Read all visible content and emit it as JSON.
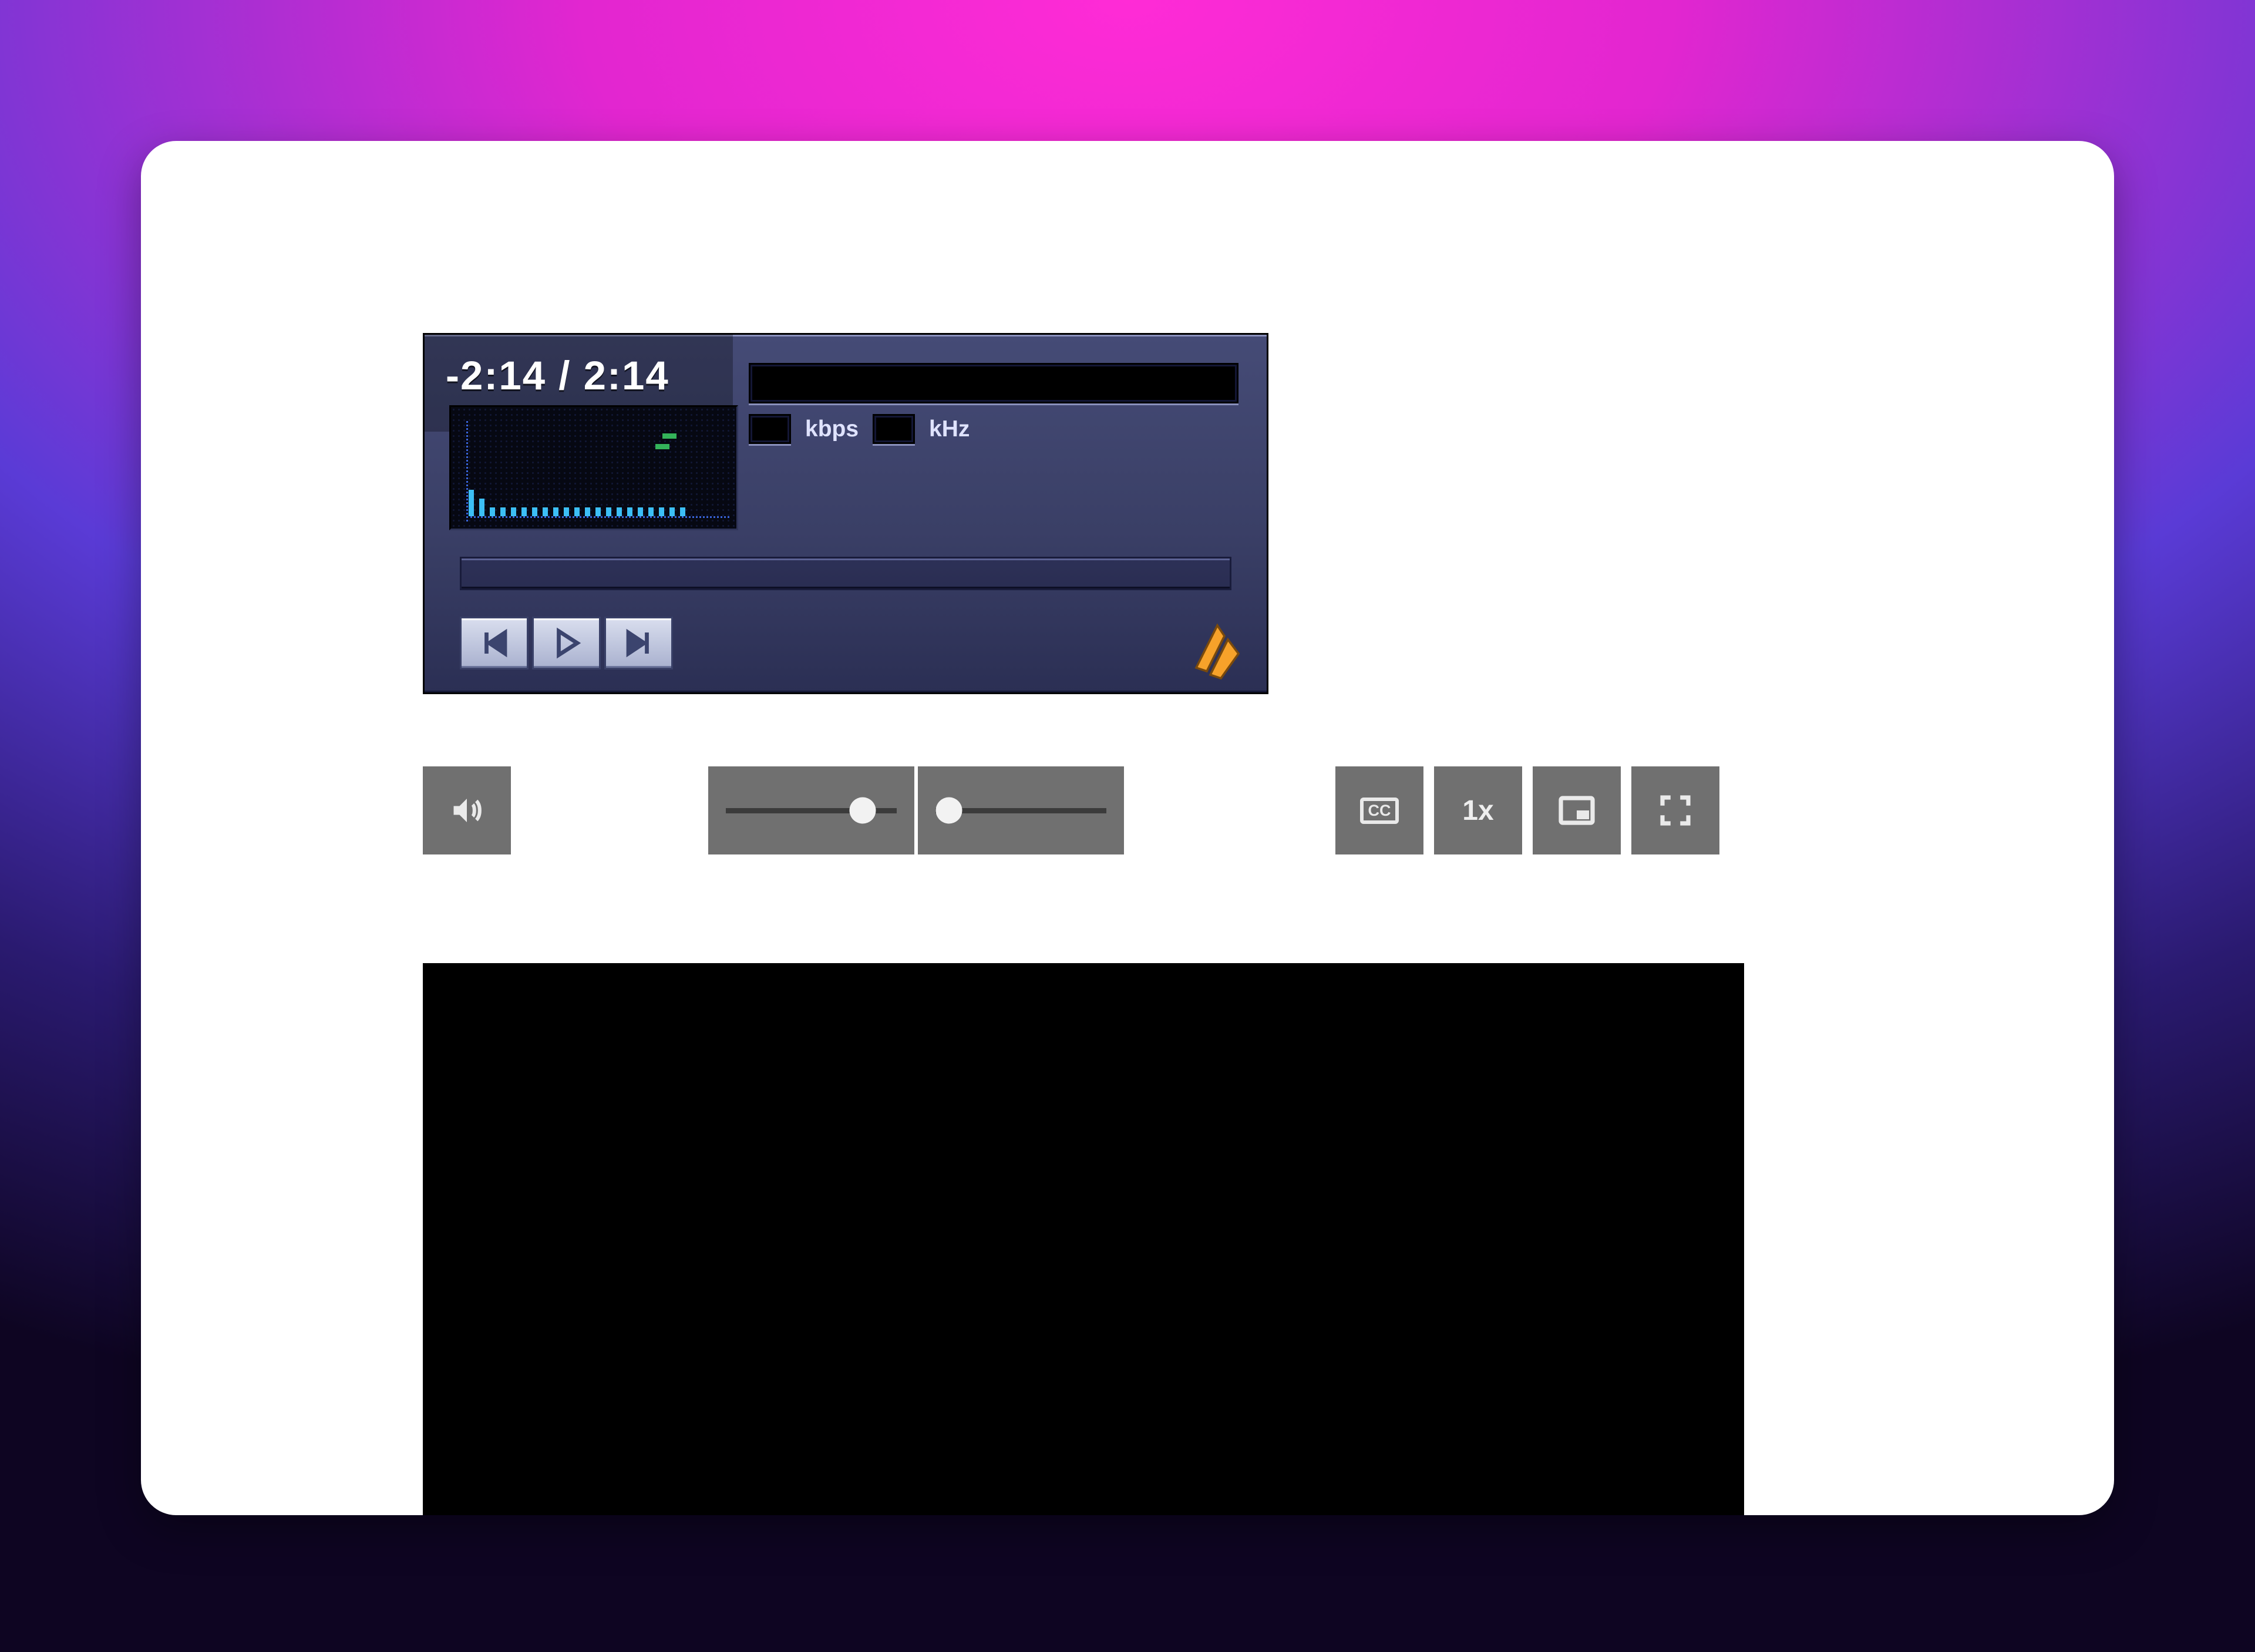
{
  "winamp": {
    "time_display": "-2:14 / 2:14",
    "bitrate_label": "kbps",
    "samplerate_label": "kHz"
  },
  "controls": {
    "speed_label": "1x",
    "cc_label": "CC"
  }
}
